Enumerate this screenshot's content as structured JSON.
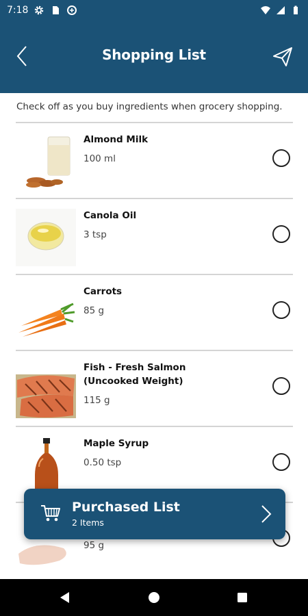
{
  "status_bar": {
    "time": "7:18"
  },
  "header": {
    "title": "Shopping List",
    "back_icon": "back-arrow-icon",
    "send_icon": "paper-plane-icon"
  },
  "subtitle": "Check off as you buy ingredients when grocery shopping.",
  "items": [
    {
      "name": "Almond Milk",
      "quantity": "100 ml",
      "checked": false
    },
    {
      "name": "Canola Oil",
      "quantity": "3 tsp",
      "checked": false
    },
    {
      "name": "Carrots",
      "quantity": "85 g",
      "checked": false
    },
    {
      "name": "Fish - Fresh Salmon (Uncooked Weight)",
      "quantity": "115 g",
      "checked": false
    },
    {
      "name": "Maple Syrup",
      "quantity": "0.50 tsp",
      "checked": false
    },
    {
      "name": "",
      "quantity": "95 g",
      "checked": false
    }
  ],
  "purchased": {
    "title": "Purchased List",
    "count_label": "2 Items"
  },
  "colors": {
    "primary": "#1b5276",
    "background": "#ffffff",
    "nav_bar": "#000000"
  }
}
